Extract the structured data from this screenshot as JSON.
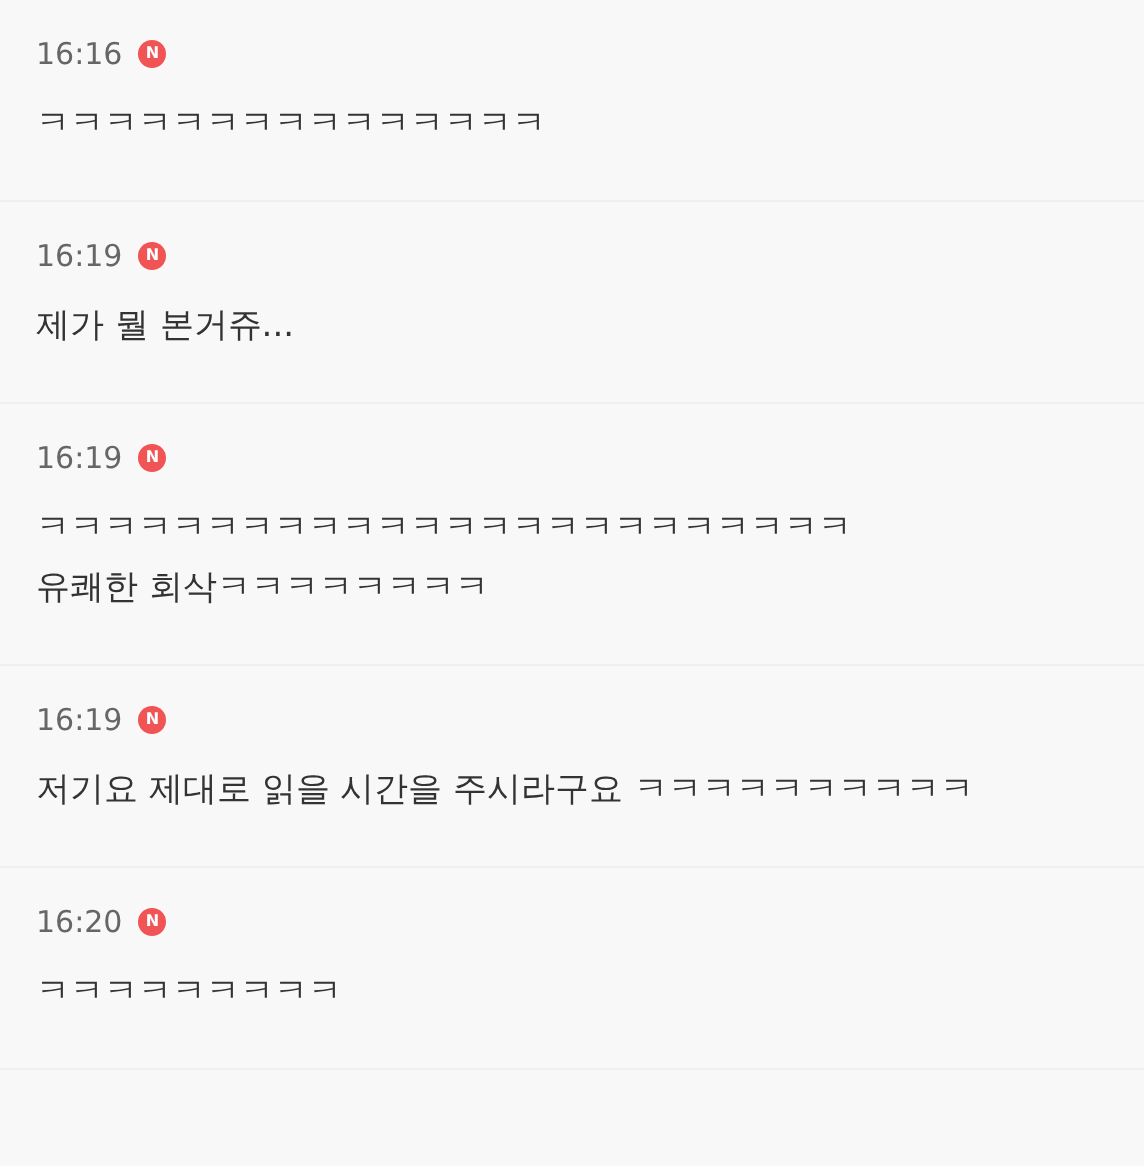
{
  "comments": [
    {
      "time": "16:16",
      "badge": "N",
      "lines": [
        "ㅋㅋㅋㅋㅋㅋㅋㅋㅋㅋㅋㅋㅋㅋㅋ"
      ]
    },
    {
      "time": "16:19",
      "badge": "N",
      "lines": [
        "제가 뭘 본거쥬..."
      ]
    },
    {
      "time": "16:19",
      "badge": "N",
      "lines": [
        "ㅋㅋㅋㅋㅋㅋㅋㅋㅋㅋㅋㅋㅋㅋㅋㅋㅋㅋㅋㅋㅋㅋㅋㅋ",
        "유쾌한 회삭ㅋㅋㅋㅋㅋㅋㅋㅋ"
      ]
    },
    {
      "time": "16:19",
      "badge": "N",
      "lines": [
        "저기요 제대로 읽을 시간을 주시라구요 ㅋㅋㅋㅋㅋㅋㅋㅋㅋㅋ"
      ]
    },
    {
      "time": "16:20",
      "badge": "N",
      "lines": [
        "ㅋㅋㅋㅋㅋㅋㅋㅋㅋ"
      ]
    }
  ]
}
